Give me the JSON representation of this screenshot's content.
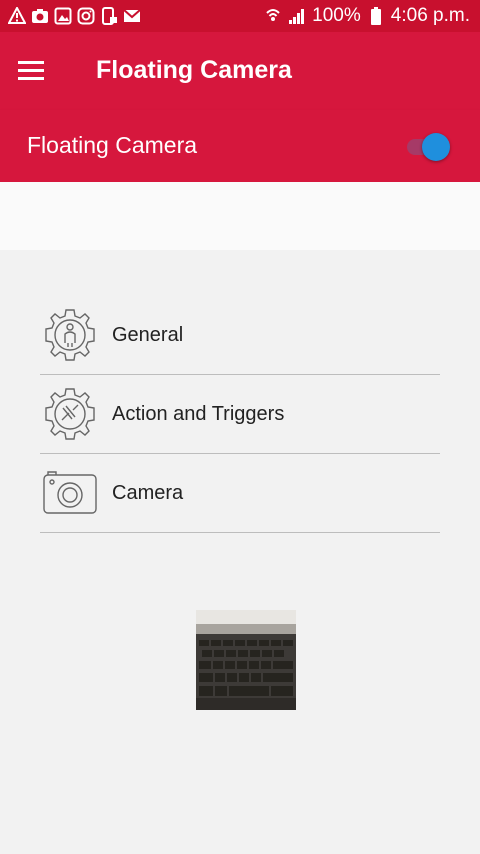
{
  "status_bar": {
    "left_icons": [
      "warning-icon",
      "camera-notification-icon",
      "gallery-icon",
      "instagram-icon",
      "phone-lock-icon",
      "mail-icon"
    ],
    "battery": "100%",
    "time": "4:06 p.m."
  },
  "app_bar": {
    "title": "Floating Camera"
  },
  "toggle": {
    "label": "Floating Camera",
    "state": "on"
  },
  "menu": {
    "items": [
      {
        "label": "General",
        "icon": "general-gear-icon"
      },
      {
        "label": "Action and Triggers",
        "icon": "action-gear-icon"
      },
      {
        "label": "Camera",
        "icon": "camera-icon"
      }
    ]
  },
  "colors": {
    "primary": "#d6173d",
    "status_bar": "#c8102e",
    "switch_thumb": "#1f8fdd",
    "background": "#f2f2f2"
  }
}
